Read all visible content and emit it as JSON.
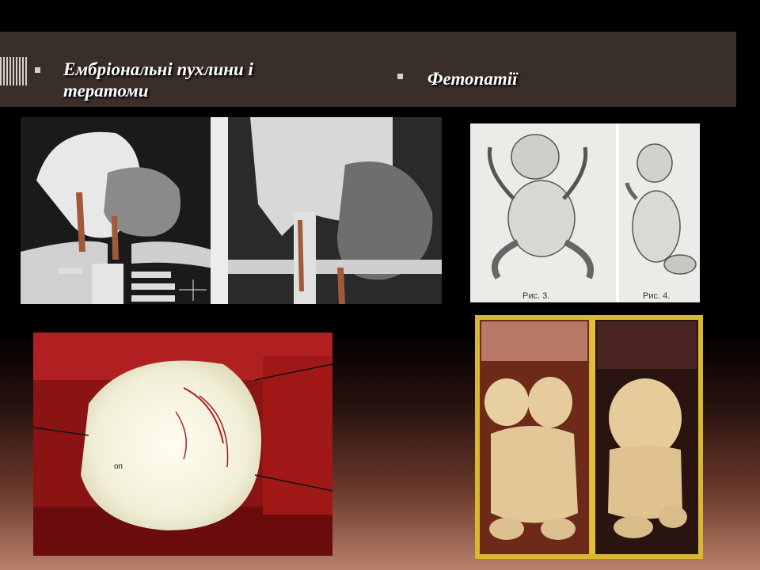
{
  "headings": {
    "left_line1": "Ембріональні пухлини і",
    "left_line2": "тератоми",
    "right": "Фетопатії"
  },
  "figures": {
    "fig3_caption": "Рис. 3.",
    "fig4_caption": "Рис. 4.",
    "surgery_label": "оп"
  },
  "colors": {
    "header_band": "#3a2e28",
    "heading_text": "#ffffff",
    "bullet": "#d9d0c4",
    "frame_yellow": "#d8b830"
  }
}
